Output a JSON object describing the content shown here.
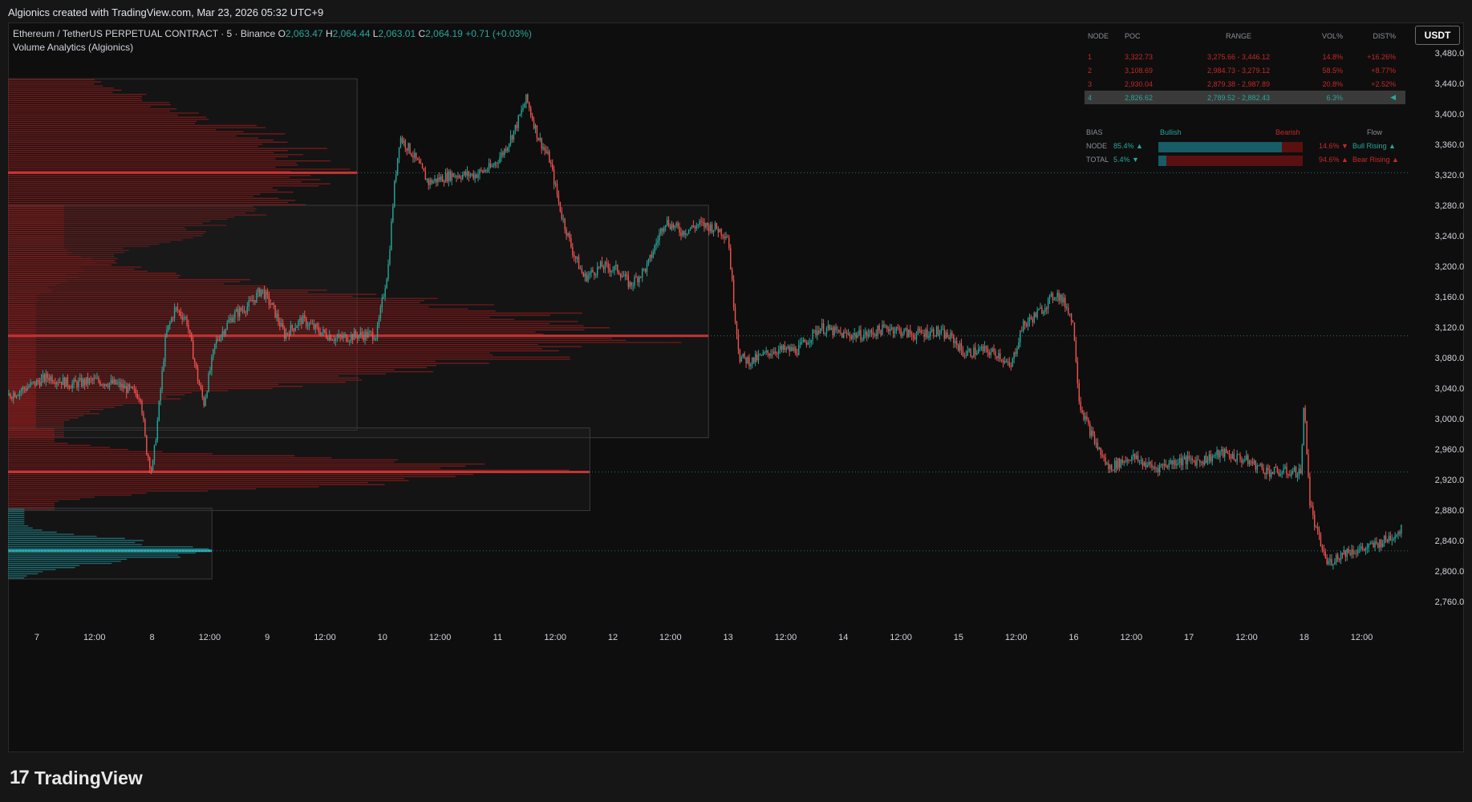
{
  "header": {
    "caption": "Algionics created with TradingView.com, Mar 23, 2026 05:32 UTC+9"
  },
  "legend": {
    "symbol": "Ethereum / TetherUS PERPETUAL CONTRACT · 5 · Binance",
    "open_label": "O",
    "open": "2,063.47",
    "high_label": "H",
    "high": "2,064.44",
    "low_label": "L",
    "low": "2,063.01",
    "close_label": "C",
    "close": "2,064.19",
    "change": "+0.71 (+0.03%)",
    "indicator": "Volume Analytics (Algionics)"
  },
  "currency_button": "USDT",
  "footer": {
    "brand": "TradingView",
    "logo_glyph": "17"
  },
  "node_table": {
    "headers": [
      "NODE",
      "POC",
      "RANGE",
      "VOL%",
      "DIST%"
    ],
    "rows": [
      {
        "node": "1",
        "poc": "3,322.73",
        "range": "3,275.66 - 3,446.12",
        "vol": "14.8%",
        "dist": "+16.26%",
        "color": "#c62828",
        "highlight": false
      },
      {
        "node": "2",
        "poc": "3,108.69",
        "range": "2,984.73 - 3,279.12",
        "vol": "58.5%",
        "dist": "+8.77%",
        "color": "#c62828",
        "highlight": false
      },
      {
        "node": "3",
        "poc": "2,930.04",
        "range": "2,879.38 - 2,987.89",
        "vol": "20.8%",
        "dist": "+2.52%",
        "color": "#c62828",
        "highlight": false
      },
      {
        "node": "4",
        "poc": "2,826.62",
        "range": "2,789.52 - 2,882.43",
        "vol": "6.3%",
        "dist": "◀",
        "color": "#26a69a",
        "highlight": true
      }
    ]
  },
  "bias_panel": {
    "header": {
      "label": "BIAS",
      "bullish": "Bullish",
      "bearish": "Bearish",
      "flow": "Flow"
    },
    "rows": [
      {
        "label": "NODE",
        "bull_pct": "85.4% ▲",
        "bear_pct": "14.6% ▼",
        "flow": "Bull Rising ▲",
        "flow_color": "#26a69a",
        "bull_fraction": 0.854
      },
      {
        "label": "TOTAL",
        "bull_pct": "5.4% ▼",
        "bear_pct": "94.6% ▲",
        "flow": "Bear Rising ▲",
        "flow_color": "#c62828",
        "bull_fraction": 0.054
      }
    ]
  },
  "colors": {
    "bull": "#26a69a",
    "bear": "#ef5350",
    "background": "#0e0e0e",
    "profile_red": "#8b1a1a",
    "poc_red": "#d32f2f",
    "profile_teal": "#1e7f86"
  },
  "chart_data": {
    "type": "candlestick",
    "symbol": "ETHUSDT.P",
    "timeframe": "5",
    "x_ticks": [
      "7",
      "12:00",
      "8",
      "12:00",
      "9",
      "12:00",
      "10",
      "12:00",
      "11",
      "12:00",
      "12",
      "12:00",
      "13",
      "12:00",
      "14",
      "12:00",
      "15",
      "12:00",
      "16",
      "12:00",
      "17",
      "12:00",
      "18",
      "12:00"
    ],
    "y_ticks": [
      "3,480.00",
      "3,440.00",
      "3,400.00",
      "3,360.00",
      "3,320.00",
      "3,280.00",
      "3,240.00",
      "3,200.00",
      "3,160.00",
      "3,120.00",
      "3,080.00",
      "3,040.00",
      "3,000.00",
      "2,960.00",
      "2,920.00",
      "2,880.00",
      "2,840.00",
      "2,800.00",
      "2,760.00"
    ],
    "y_values": [
      3480,
      3440,
      3400,
      3360,
      3320,
      3280,
      3240,
      3200,
      3160,
      3120,
      3080,
      3040,
      3000,
      2960,
      2920,
      2880,
      2840,
      2800,
      2760
    ],
    "ylim": [
      2720,
      3520
    ],
    "day_index_range": [
      6.75,
      18.9
    ],
    "price_path": [
      [
        6.75,
        3030
      ],
      [
        6.9,
        3040
      ],
      [
        7.1,
        3055
      ],
      [
        7.3,
        3045
      ],
      [
        7.5,
        3050
      ],
      [
        7.7,
        3045
      ],
      [
        7.9,
        3030
      ],
      [
        7.95,
        2960
      ],
      [
        8.0,
        2930
      ],
      [
        8.05,
        3000
      ],
      [
        8.12,
        3110
      ],
      [
        8.2,
        3145
      ],
      [
        8.3,
        3130
      ],
      [
        8.4,
        3050
      ],
      [
        8.45,
        3020
      ],
      [
        8.55,
        3100
      ],
      [
        8.7,
        3135
      ],
      [
        8.85,
        3150
      ],
      [
        8.95,
        3170
      ],
      [
        9.05,
        3145
      ],
      [
        9.15,
        3110
      ],
      [
        9.3,
        3130
      ],
      [
        9.45,
        3115
      ],
      [
        9.6,
        3105
      ],
      [
        9.8,
        3110
      ],
      [
        9.95,
        3110
      ],
      [
        10.05,
        3200
      ],
      [
        10.1,
        3300
      ],
      [
        10.15,
        3370
      ],
      [
        10.25,
        3350
      ],
      [
        10.4,
        3310
      ],
      [
        10.6,
        3320
      ],
      [
        10.8,
        3320
      ],
      [
        10.95,
        3330
      ],
      [
        11.05,
        3350
      ],
      [
        11.15,
        3380
      ],
      [
        11.25,
        3420
      ],
      [
        11.35,
        3370
      ],
      [
        11.45,
        3340
      ],
      [
        11.55,
        3270
      ],
      [
        11.65,
        3220
      ],
      [
        11.75,
        3185
      ],
      [
        11.9,
        3200
      ],
      [
        12.05,
        3195
      ],
      [
        12.15,
        3175
      ],
      [
        12.3,
        3200
      ],
      [
        12.45,
        3260
      ],
      [
        12.6,
        3245
      ],
      [
        12.75,
        3255
      ],
      [
        12.9,
        3250
      ],
      [
        13.0,
        3240
      ],
      [
        13.05,
        3150
      ],
      [
        13.1,
        3080
      ],
      [
        13.2,
        3075
      ],
      [
        13.4,
        3090
      ],
      [
        13.6,
        3090
      ],
      [
        13.8,
        3120
      ],
      [
        14.0,
        3110
      ],
      [
        14.2,
        3110
      ],
      [
        14.4,
        3120
      ],
      [
        14.6,
        3110
      ],
      [
        14.8,
        3115
      ],
      [
        14.95,
        3105
      ],
      [
        15.05,
        3085
      ],
      [
        15.2,
        3090
      ],
      [
        15.35,
        3085
      ],
      [
        15.45,
        3065
      ],
      [
        15.55,
        3120
      ],
      [
        15.7,
        3140
      ],
      [
        15.85,
        3165
      ],
      [
        15.95,
        3145
      ],
      [
        16.0,
        3120
      ],
      [
        16.05,
        3020
      ],
      [
        16.15,
        2980
      ],
      [
        16.3,
        2935
      ],
      [
        16.5,
        2950
      ],
      [
        16.7,
        2935
      ],
      [
        16.9,
        2945
      ],
      [
        17.1,
        2945
      ],
      [
        17.3,
        2955
      ],
      [
        17.5,
        2945
      ],
      [
        17.7,
        2930
      ],
      [
        17.9,
        2930
      ],
      [
        17.97,
        2930
      ],
      [
        18.0,
        3020
      ],
      [
        18.05,
        2890
      ],
      [
        18.1,
        2855
      ],
      [
        18.2,
        2810
      ],
      [
        18.35,
        2825
      ],
      [
        18.55,
        2830
      ],
      [
        18.7,
        2840
      ],
      [
        18.85,
        2855
      ]
    ],
    "volume_profiles": [
      {
        "range": [
          2984.73,
          3446.12
        ],
        "day_span": [
          6.75,
          9.78
        ],
        "poc": 3322.73,
        "color": "bear",
        "bull_fraction": 0.0
      },
      {
        "range": [
          2975,
          3280
        ],
        "day_span": [
          6.75,
          12.83
        ],
        "poc": 3108.69,
        "color": "bear",
        "bull_fraction": 0.0
      },
      {
        "range": [
          2879.38,
          2987.89
        ],
        "day_span": [
          6.75,
          11.8
        ],
        "poc": 2930.04,
        "color": "bear",
        "bull_fraction": 0.0
      },
      {
        "range": [
          2789.52,
          2882.43
        ],
        "day_span": [
          6.75,
          8.52
        ],
        "poc": 2826.62,
        "color": "bull",
        "bull_fraction": 1.0
      }
    ],
    "poc_lines": [
      3322.73,
      3108.69,
      2930.04,
      2826.62
    ],
    "grid": false
  }
}
